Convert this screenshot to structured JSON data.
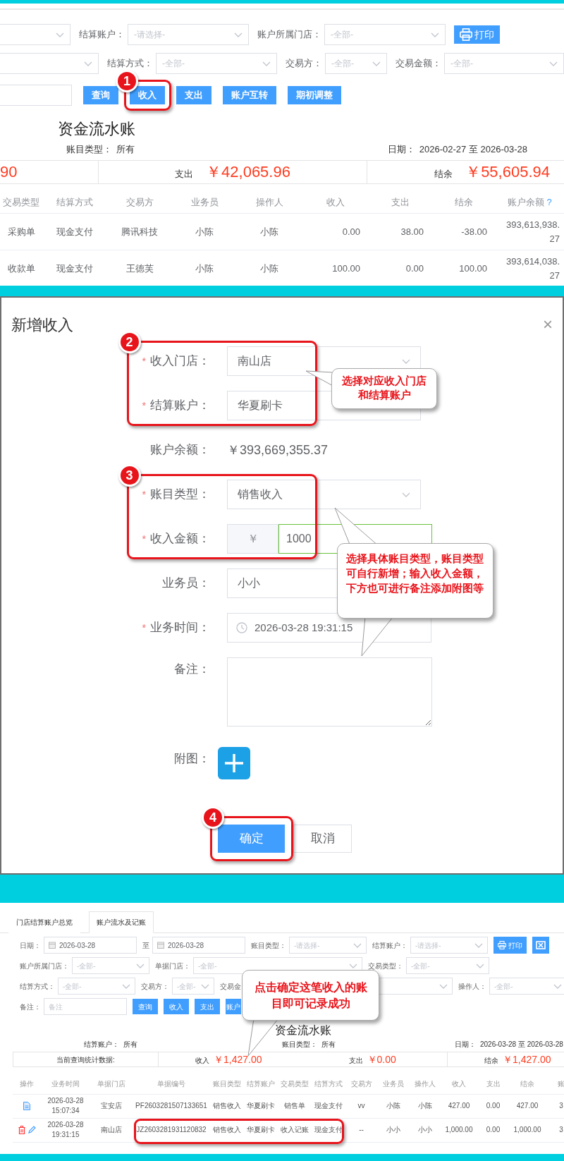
{
  "top_panel": {
    "filter_rows": [
      [
        {
          "kind": "select"
        },
        {
          "kind": "select",
          "label": "结算账户：",
          "placeholder": "-请选择-"
        },
        {
          "kind": "select",
          "label": "账户所属门店：",
          "placeholder": "-全部-"
        },
        {
          "kind": "print_button",
          "label": "打印"
        }
      ],
      [
        {
          "kind": "select"
        },
        {
          "kind": "select",
          "label": "结算方式：",
          "placeholder": "-全部-"
        },
        {
          "kind": "select",
          "label": "交易方：",
          "placeholder": "-全部-"
        },
        {
          "kind": "select",
          "label": "交易金额：",
          "placeholder": "-全部-"
        }
      ],
      [
        {
          "kind": "input"
        },
        {
          "kind": "button",
          "label": "查询"
        },
        {
          "kind": "button",
          "label": "收入"
        },
        {
          "kind": "button",
          "label": "支出"
        },
        {
          "kind": "button",
          "label": "账户互转"
        },
        {
          "kind": "button",
          "label": "期初调整"
        }
      ]
    ],
    "title": "资金流水账",
    "meta": [
      {
        "label": "账目类型：",
        "value": "所有"
      },
      {
        "label": "日期：",
        "value": "2026-02-27 至 2026-03-28"
      }
    ],
    "summary": [
      {
        "amount": "90"
      },
      {
        "label": "支出",
        "amount": "￥42,065.96"
      },
      {
        "label": "结余",
        "amount": "￥55,605.94"
      }
    ],
    "columns": [
      "交易类型",
      "结算方式",
      "交易方",
      "业务员",
      "操作人",
      "收入",
      "支出",
      "结余",
      "账户余额"
    ],
    "balance_help": "?",
    "rows": [
      [
        "采购单",
        "现金支付",
        "腾讯科技",
        "小陈",
        "小陈",
        "0.00",
        "38.00",
        "-38.00",
        "393,613,938.27"
      ],
      [
        "收款单",
        "现金支付",
        "王德芙",
        "小陈",
        "小陈",
        "100.00",
        "0.00",
        "100.00",
        "393,614,038.27"
      ]
    ],
    "annotations": [
      {
        "kind": "numbered_frame",
        "step": "1"
      }
    ]
  },
  "dialog": {
    "title": "新增收入",
    "close": "×",
    "groups": [
      {
        "fields": [
          {
            "kind": "select",
            "label": "收入门店：",
            "required_mark": "*",
            "value": "南山店"
          },
          {
            "kind": "select",
            "label": "结算账户：",
            "required_mark": "*",
            "value": "华夏刷卡"
          }
        ]
      },
      {
        "fields": [
          {
            "kind": "text",
            "label": "账户余额：",
            "value": "￥393,669,355.37"
          }
        ]
      },
      {
        "fields": [
          {
            "kind": "select",
            "label": "账目类型：",
            "required_mark": "*",
            "value": "销售收入"
          },
          {
            "kind": "amount",
            "label": "收入金额：",
            "required_mark": "*",
            "prefix": "￥",
            "value": "1000",
            "focused": true
          }
        ]
      },
      {
        "fields": [
          {
            "kind": "select",
            "label": "业务员：",
            "value": "小小"
          },
          {
            "kind": "datetime",
            "label": "业务时间：",
            "required_mark": "*",
            "value": "2026-03-28 19:31:15"
          },
          {
            "kind": "textarea",
            "label": "备注："
          },
          {
            "kind": "upload",
            "label": "附图："
          }
        ]
      }
    ],
    "buttons": [
      {
        "label": "确定",
        "primary": true
      },
      {
        "label": "取消",
        "primary": false
      }
    ],
    "callouts": [
      "选择对应收入门店和结算账户",
      "选择具体账目类型，账目类型可自行新增；输入收入金额，下方也可进行备注添加附图等"
    ],
    "annotations": [
      {
        "kind": "numbered_frame",
        "step": "2"
      },
      {
        "kind": "numbered_frame",
        "step": "3"
      },
      {
        "kind": "numbered_frame",
        "step": "4"
      }
    ]
  },
  "bottom_panel": {
    "tabs": [
      {
        "label": "门店结算账户总览",
        "selected": false
      },
      {
        "label": "账户流水及记账",
        "selected": true
      }
    ],
    "filter_rows": [
      [
        {
          "kind": "date",
          "label": "日期：",
          "value": "2026-03-28"
        },
        {
          "kind": "date",
          "label": "至",
          "value": "2026-03-28"
        },
        {
          "kind": "select",
          "label": "账目类型：",
          "placeholder": "-请选择-"
        },
        {
          "kind": "select",
          "label": "结算账户：",
          "placeholder": "-请选择-"
        },
        {
          "kind": "print_button",
          "label": "打印"
        },
        {
          "kind": "export_button"
        }
      ],
      [
        {
          "kind": "select",
          "label": "账户所属门店：",
          "placeholder": "-全部-"
        },
        {
          "kind": "select",
          "label": "单据门店：",
          "placeholder": "-全部-"
        },
        {
          "kind": "select",
          "label": "交易类型：",
          "placeholder": "-全部-"
        }
      ],
      [
        {
          "kind": "select",
          "label": "结算方式：",
          "placeholder": "-全部-"
        },
        {
          "kind": "select",
          "label": "交易方：",
          "placeholder": "-全部-"
        },
        {
          "kind": "select",
          "label": "交易金"
        },
        {
          "kind": "select",
          "label": "操作人：",
          "placeholder": "-全部-"
        }
      ],
      [
        {
          "kind": "input",
          "label": "备注：",
          "placeholder": "备注"
        },
        {
          "kind": "button",
          "label": "查询"
        },
        {
          "kind": "button",
          "label": "收入"
        },
        {
          "kind": "button",
          "label": "支出"
        },
        {
          "kind": "button",
          "label": "账户"
        }
      ]
    ],
    "title": "资金流水账",
    "meta": [
      {
        "label": "结算账户：",
        "value": "所有"
      },
      {
        "label": "账目类型：",
        "value": "所有"
      },
      {
        "label": "日期：",
        "value": "2026-03-28 至 2026-03-28"
      }
    ],
    "summary_label": "当前查询统计数据:",
    "summary": [
      {
        "label": "收入",
        "amount": "￥1,427.00"
      },
      {
        "label": "支出",
        "amount": "￥0.00"
      },
      {
        "label": "结余",
        "amount": "￥1,427.00"
      }
    ],
    "columns": [
      "操作",
      "业务时间",
      "单据门店",
      "单据编号",
      "账目类型",
      "结算账户",
      "交易类型",
      "结算方式",
      "交易方",
      "业务员",
      "操作人",
      "收入",
      "支出",
      "结余",
      "账"
    ],
    "rows": [
      {
        "kind": "view_only",
        "cells": [
          "",
          "2026-03-28 15:07:34",
          "宝安店",
          "PF2603281507133651",
          "销售收入",
          "华夏刷卡",
          "销售单",
          "现金支付",
          "vv",
          "小陈",
          "小陈",
          "427.00",
          "0.00",
          "427.00",
          "3"
        ]
      },
      {
        "kind": "editable",
        "cells": [
          "",
          "2026-03-28 19:31:15",
          "南山店",
          "JZ2603281931120832",
          "销售收入",
          "华夏刷卡",
          "收入记账",
          "现金支付",
          "--",
          "小小",
          "小小",
          "1,000.00",
          "0.00",
          "1,000.00",
          "3"
        ]
      }
    ],
    "callout": "点击确定这笔收入的账目即可记录成功",
    "annotations": [
      {
        "kind": "frame"
      }
    ]
  }
}
